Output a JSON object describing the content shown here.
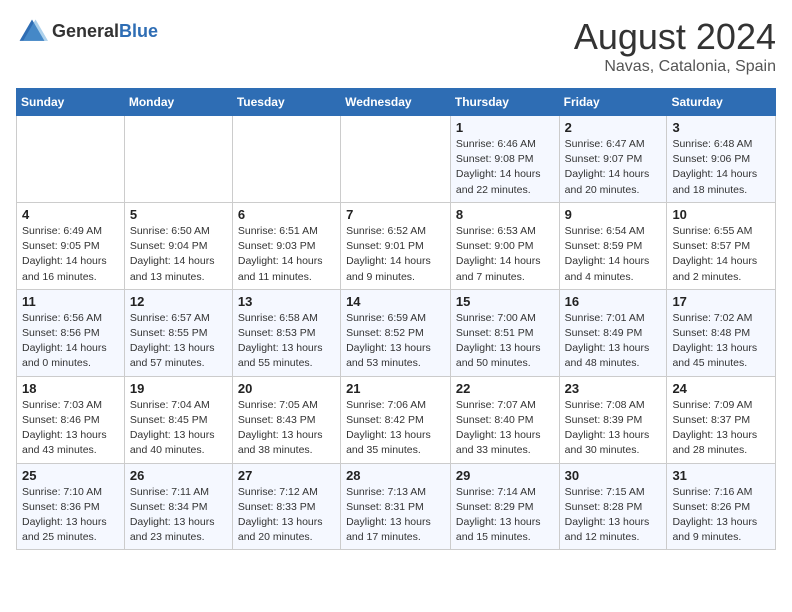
{
  "logo": {
    "general": "General",
    "blue": "Blue"
  },
  "title": "August 2024",
  "subtitle": "Navas, Catalonia, Spain",
  "weekdays": [
    "Sunday",
    "Monday",
    "Tuesday",
    "Wednesday",
    "Thursday",
    "Friday",
    "Saturday"
  ],
  "weeks": [
    [
      {
        "num": "",
        "info": ""
      },
      {
        "num": "",
        "info": ""
      },
      {
        "num": "",
        "info": ""
      },
      {
        "num": "",
        "info": ""
      },
      {
        "num": "1",
        "info": "Sunrise: 6:46 AM\nSunset: 9:08 PM\nDaylight: 14 hours and 22 minutes."
      },
      {
        "num": "2",
        "info": "Sunrise: 6:47 AM\nSunset: 9:07 PM\nDaylight: 14 hours and 20 minutes."
      },
      {
        "num": "3",
        "info": "Sunrise: 6:48 AM\nSunset: 9:06 PM\nDaylight: 14 hours and 18 minutes."
      }
    ],
    [
      {
        "num": "4",
        "info": "Sunrise: 6:49 AM\nSunset: 9:05 PM\nDaylight: 14 hours and 16 minutes."
      },
      {
        "num": "5",
        "info": "Sunrise: 6:50 AM\nSunset: 9:04 PM\nDaylight: 14 hours and 13 minutes."
      },
      {
        "num": "6",
        "info": "Sunrise: 6:51 AM\nSunset: 9:03 PM\nDaylight: 14 hours and 11 minutes."
      },
      {
        "num": "7",
        "info": "Sunrise: 6:52 AM\nSunset: 9:01 PM\nDaylight: 14 hours and 9 minutes."
      },
      {
        "num": "8",
        "info": "Sunrise: 6:53 AM\nSunset: 9:00 PM\nDaylight: 14 hours and 7 minutes."
      },
      {
        "num": "9",
        "info": "Sunrise: 6:54 AM\nSunset: 8:59 PM\nDaylight: 14 hours and 4 minutes."
      },
      {
        "num": "10",
        "info": "Sunrise: 6:55 AM\nSunset: 8:57 PM\nDaylight: 14 hours and 2 minutes."
      }
    ],
    [
      {
        "num": "11",
        "info": "Sunrise: 6:56 AM\nSunset: 8:56 PM\nDaylight: 14 hours and 0 minutes."
      },
      {
        "num": "12",
        "info": "Sunrise: 6:57 AM\nSunset: 8:55 PM\nDaylight: 13 hours and 57 minutes."
      },
      {
        "num": "13",
        "info": "Sunrise: 6:58 AM\nSunset: 8:53 PM\nDaylight: 13 hours and 55 minutes."
      },
      {
        "num": "14",
        "info": "Sunrise: 6:59 AM\nSunset: 8:52 PM\nDaylight: 13 hours and 53 minutes."
      },
      {
        "num": "15",
        "info": "Sunrise: 7:00 AM\nSunset: 8:51 PM\nDaylight: 13 hours and 50 minutes."
      },
      {
        "num": "16",
        "info": "Sunrise: 7:01 AM\nSunset: 8:49 PM\nDaylight: 13 hours and 48 minutes."
      },
      {
        "num": "17",
        "info": "Sunrise: 7:02 AM\nSunset: 8:48 PM\nDaylight: 13 hours and 45 minutes."
      }
    ],
    [
      {
        "num": "18",
        "info": "Sunrise: 7:03 AM\nSunset: 8:46 PM\nDaylight: 13 hours and 43 minutes."
      },
      {
        "num": "19",
        "info": "Sunrise: 7:04 AM\nSunset: 8:45 PM\nDaylight: 13 hours and 40 minutes."
      },
      {
        "num": "20",
        "info": "Sunrise: 7:05 AM\nSunset: 8:43 PM\nDaylight: 13 hours and 38 minutes."
      },
      {
        "num": "21",
        "info": "Sunrise: 7:06 AM\nSunset: 8:42 PM\nDaylight: 13 hours and 35 minutes."
      },
      {
        "num": "22",
        "info": "Sunrise: 7:07 AM\nSunset: 8:40 PM\nDaylight: 13 hours and 33 minutes."
      },
      {
        "num": "23",
        "info": "Sunrise: 7:08 AM\nSunset: 8:39 PM\nDaylight: 13 hours and 30 minutes."
      },
      {
        "num": "24",
        "info": "Sunrise: 7:09 AM\nSunset: 8:37 PM\nDaylight: 13 hours and 28 minutes."
      }
    ],
    [
      {
        "num": "25",
        "info": "Sunrise: 7:10 AM\nSunset: 8:36 PM\nDaylight: 13 hours and 25 minutes."
      },
      {
        "num": "26",
        "info": "Sunrise: 7:11 AM\nSunset: 8:34 PM\nDaylight: 13 hours and 23 minutes."
      },
      {
        "num": "27",
        "info": "Sunrise: 7:12 AM\nSunset: 8:33 PM\nDaylight: 13 hours and 20 minutes."
      },
      {
        "num": "28",
        "info": "Sunrise: 7:13 AM\nSunset: 8:31 PM\nDaylight: 13 hours and 17 minutes."
      },
      {
        "num": "29",
        "info": "Sunrise: 7:14 AM\nSunset: 8:29 PM\nDaylight: 13 hours and 15 minutes."
      },
      {
        "num": "30",
        "info": "Sunrise: 7:15 AM\nSunset: 8:28 PM\nDaylight: 13 hours and 12 minutes."
      },
      {
        "num": "31",
        "info": "Sunrise: 7:16 AM\nSunset: 8:26 PM\nDaylight: 13 hours and 9 minutes."
      }
    ]
  ]
}
